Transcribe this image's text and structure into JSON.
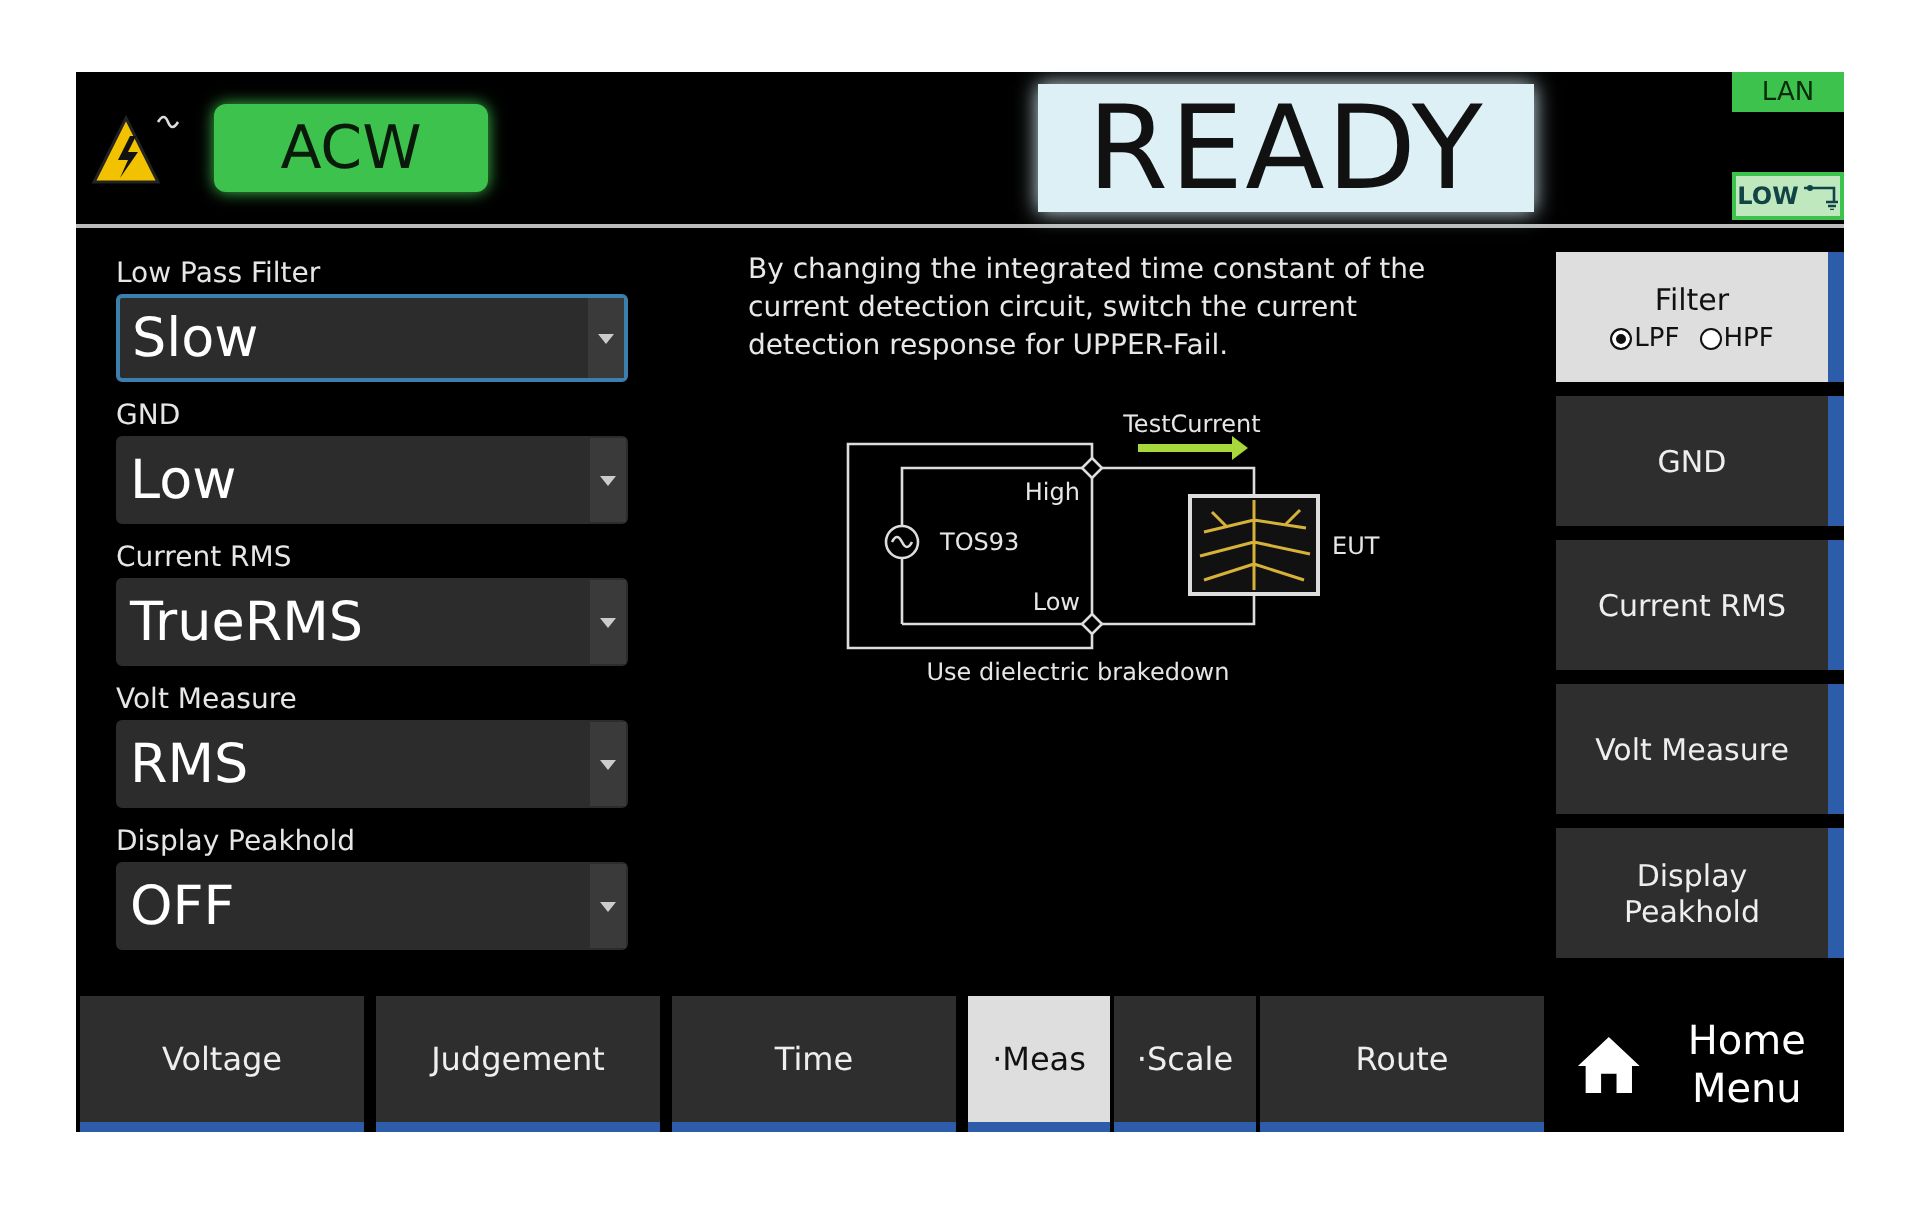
{
  "header": {
    "mode": "ACW",
    "status": "READY",
    "badges": [
      {
        "kind": "text",
        "label": "LAN"
      },
      {
        "kind": "ground",
        "label": "LOW"
      }
    ]
  },
  "settings": [
    {
      "label": "Low Pass Filter",
      "value": "Slow",
      "selected": true
    },
    {
      "label": "GND",
      "value": "Low",
      "selected": false
    },
    {
      "label": "Current RMS",
      "value": "TrueRMS",
      "selected": false
    },
    {
      "label": "Volt Measure",
      "value": "RMS",
      "selected": false
    },
    {
      "label": "Display Peakhold",
      "value": "OFF",
      "selected": false
    }
  ],
  "description": "By changing the integrated time constant of the current detection circuit, switch the current detection response for UPPER-Fail.",
  "diagram": {
    "arrow_label": "TestCurrent",
    "high": "High",
    "source": "TOS93",
    "low": "Low",
    "load": "EUT",
    "caption": "Use dielectric brakedown"
  },
  "side_buttons": [
    {
      "kind": "radio",
      "label": "Filter",
      "selected": true,
      "options": [
        {
          "label": "LPF",
          "selected": true
        },
        {
          "label": "HPF",
          "selected": false
        }
      ]
    },
    {
      "kind": "plain",
      "label": "GND",
      "selected": false
    },
    {
      "kind": "plain",
      "label": "Current RMS",
      "selected": false
    },
    {
      "kind": "plain",
      "label": "Volt Measure",
      "selected": false
    },
    {
      "kind": "plain",
      "label": "Display Peakhold",
      "selected": false
    }
  ],
  "tabs": [
    {
      "kind": "tab",
      "label": "Voltage",
      "selected": false
    },
    {
      "kind": "tab",
      "label": "Judgement",
      "selected": false
    },
    {
      "kind": "tab",
      "label": "Time",
      "selected": false
    },
    {
      "kind": "subtab",
      "label": "·Meas",
      "selected": true
    },
    {
      "kind": "subtab",
      "label": "·Scale",
      "selected": false
    },
    {
      "kind": "tab",
      "label": "Route",
      "selected": false
    }
  ],
  "home": {
    "label": "Home Menu"
  }
}
